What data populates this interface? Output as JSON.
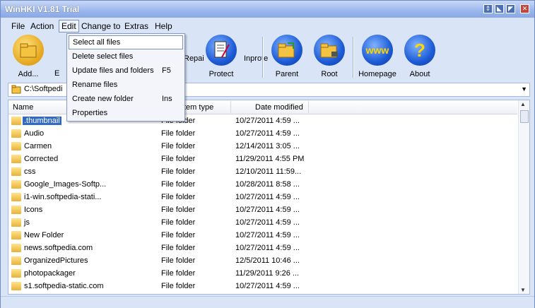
{
  "window": {
    "title": "WinHKI V1.81 Trial",
    "buttons": [
      "⇕",
      "◣",
      "◤",
      "✕"
    ]
  },
  "menubar": {
    "items": [
      "File",
      "Action",
      "Edit",
      "Change to",
      "Extras",
      "Help"
    ]
  },
  "toolbar": {
    "add_label": "Add...",
    "add_icon": "add-folder-icon",
    "hidden_first": "E",
    "repair_partial": "Repai",
    "protect_label": "Protect",
    "unprotect_partial": "Inprote",
    "parent_label": "Parent",
    "root_label": "Root",
    "homepage_label": "Homepage",
    "homepage_icon_text": "www",
    "about_label": "About",
    "about_icon_text": "?"
  },
  "address_bar": {
    "path": "C:\\Softpedi"
  },
  "table": {
    "columns": [
      "Name",
      "Item type",
      "Date modified"
    ],
    "header_partial_type": "tem type",
    "rows": [
      {
        "name": ".thumbnail",
        "type": "File folder",
        "date": "10/27/2011 4:59 ..."
      },
      {
        "name": "Audio",
        "type": "File folder",
        "date": "10/27/2011 4:59 ..."
      },
      {
        "name": "Carmen",
        "type": "File folder",
        "date": "12/14/2011 3:05 ..."
      },
      {
        "name": "Corrected",
        "type": "File folder",
        "date": "11/29/2011 4:55 PM"
      },
      {
        "name": "css",
        "type": "File folder",
        "date": "12/10/2011 11:59..."
      },
      {
        "name": "Google_Images-Softp...",
        "type": "File folder",
        "date": "10/28/2011 8:58 ..."
      },
      {
        "name": "i1-win.softpedia-stati...",
        "type": "File folder",
        "date": "10/27/2011 4:59 ..."
      },
      {
        "name": "Icons",
        "type": "File folder",
        "date": "10/27/2011 4:59 ..."
      },
      {
        "name": "js",
        "type": "File folder",
        "date": "10/27/2011 4:59 ..."
      },
      {
        "name": "New Folder",
        "type": "File folder",
        "date": "10/27/2011 4:59 ..."
      },
      {
        "name": "news.softpedia.com",
        "type": "File folder",
        "date": "10/27/2011 4:59 ..."
      },
      {
        "name": "OrganizedPictures",
        "type": "File folder",
        "date": "12/5/2011 10:46 ..."
      },
      {
        "name": "photopackager",
        "type": "File folder",
        "date": "11/29/2011 9:26 ..."
      },
      {
        "name": "s1.softpedia-static.com",
        "type": "File folder",
        "date": "10/27/2011 4:59 ..."
      }
    ]
  },
  "edit_menu": {
    "items": [
      {
        "label": "Select all files",
        "shortcut": ""
      },
      {
        "label": "Delete select files",
        "shortcut": ""
      },
      {
        "label": "Update files and folders",
        "shortcut": "F5"
      },
      {
        "label": "Rename files",
        "shortcut": ""
      },
      {
        "label": "Create new folder",
        "shortcut": "Ins"
      },
      {
        "label": "Properties",
        "shortcut": ""
      }
    ]
  }
}
